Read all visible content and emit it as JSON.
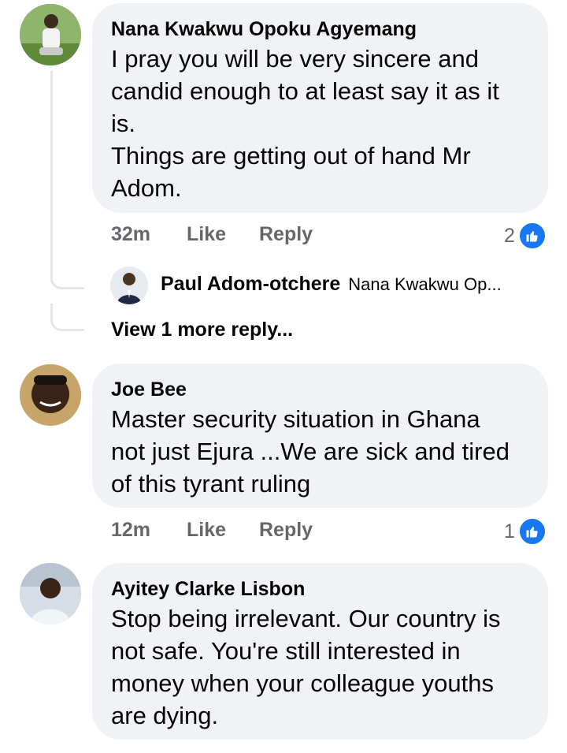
{
  "comments": [
    {
      "author": "Nana Kwakwu Opoku Agyemang",
      "text": "I pray you will be very sincere and\ncandid enough to at least say it as it\nis.\nThings are getting out of hand Mr\nAdom.",
      "time": "32m",
      "like_label": "Like",
      "reply_label": "Reply",
      "reaction_count": "2",
      "replies_preview": {
        "author": "Paul Adom-otchere",
        "snippet": "Nana Kwakwu Op..."
      },
      "view_more": "View 1 more reply..."
    },
    {
      "author": "Joe Bee",
      "text": "Master security situation in Ghana\nnot just Ejura ...We are sick and tired\nof this tyrant ruling",
      "time": "12m",
      "like_label": "Like",
      "reply_label": "Reply",
      "reaction_count": "1"
    },
    {
      "author": "Ayitey Clarke Lisbon",
      "text": "Stop being irrelevant. Our country is\nnot safe. You're still interested in\nmoney when your colleague youths\nare dying."
    }
  ],
  "colors": {
    "bubble": "#f0f2f5",
    "like_blue": "#1877f2",
    "meta_gray": "#65676b"
  },
  "icons": [
    "avatar-photo",
    "thumbs-up-icon"
  ]
}
